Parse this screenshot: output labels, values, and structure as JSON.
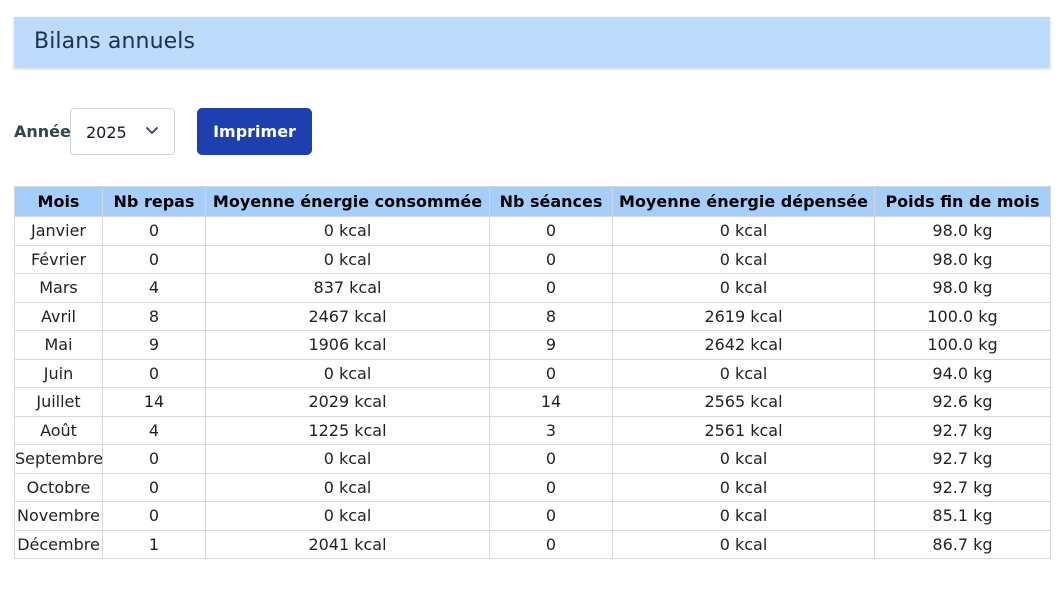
{
  "header": {
    "title": "Bilans annuels"
  },
  "controls": {
    "year_label": "Année",
    "year_value": "2025",
    "print_label": "Imprimer"
  },
  "table": {
    "columns": [
      "Mois",
      "Nb repas",
      "Moyenne énergie consommée",
      "Nb séances",
      "Moyenne énergie dépensée",
      "Poids fin de mois"
    ],
    "rows": [
      [
        "Janvier",
        "0",
        "0 kcal",
        "0",
        "0 kcal",
        "98.0 kg"
      ],
      [
        "Février",
        "0",
        "0 kcal",
        "0",
        "0 kcal",
        "98.0 kg"
      ],
      [
        "Mars",
        "4",
        "837 kcal",
        "0",
        "0 kcal",
        "98.0 kg"
      ],
      [
        "Avril",
        "8",
        "2467 kcal",
        "8",
        "2619 kcal",
        "100.0 kg"
      ],
      [
        "Mai",
        "9",
        "1906 kcal",
        "9",
        "2642 kcal",
        "100.0 kg"
      ],
      [
        "Juin",
        "0",
        "0 kcal",
        "0",
        "0 kcal",
        "94.0 kg"
      ],
      [
        "Juillet",
        "14",
        "2029 kcal",
        "14",
        "2565 kcal",
        "92.6 kg"
      ],
      [
        "Août",
        "4",
        "1225 kcal",
        "3",
        "2561 kcal",
        "92.7 kg"
      ],
      [
        "Septembre",
        "0",
        "0 kcal",
        "0",
        "0 kcal",
        "92.7 kg"
      ],
      [
        "Octobre",
        "0",
        "0 kcal",
        "0",
        "0 kcal",
        "92.7 kg"
      ],
      [
        "Novembre",
        "0",
        "0 kcal",
        "0",
        "0 kcal",
        "85.1 kg"
      ],
      [
        "Décembre",
        "1",
        "2041 kcal",
        "0",
        "0 kcal",
        "86.7 kg"
      ]
    ]
  },
  "colors": {
    "header_bg": "#bddbfb",
    "table_header_bg": "#a6cefb",
    "button_bg": "#1d40ae"
  },
  "icons": {
    "select_arrow": "chevron-down-icon"
  }
}
